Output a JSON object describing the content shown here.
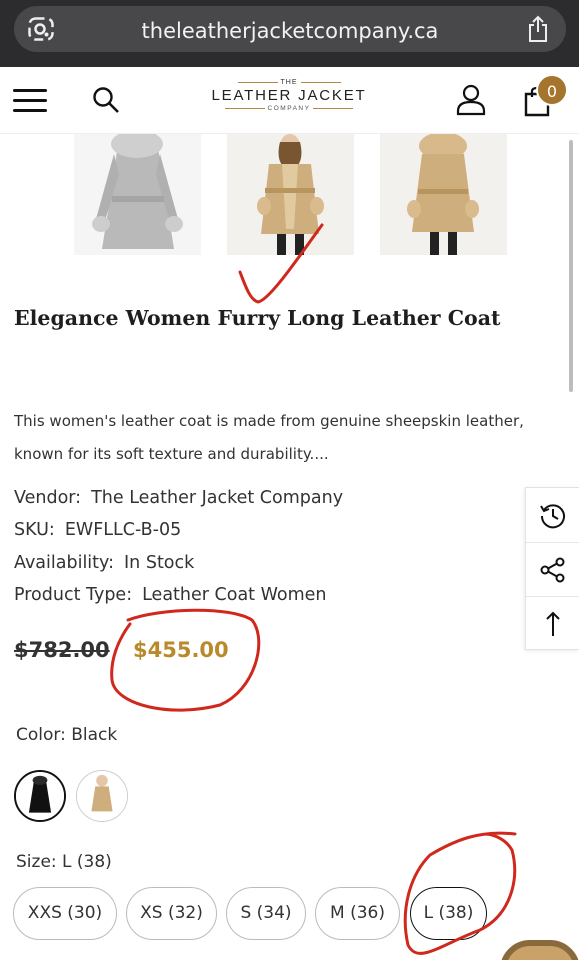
{
  "browser": {
    "url": "theleatherjacketcompany.ca"
  },
  "header": {
    "logo_the": "THE",
    "logo_main": "LEATHER JACKET",
    "logo_company": "COMPANY",
    "cart_count": "0"
  },
  "product": {
    "title": "Elegance Women Furry Long Leather Coat",
    "description": "This women's leather coat is made from genuine sheepskin leather, known for its soft texture and durability....",
    "vendor_label": "Vendor:",
    "vendor": "The Leather Jacket Company",
    "sku_label": "SKU:",
    "sku": "EWFLLC-B-05",
    "availability_label": "Availability:",
    "availability": "In Stock",
    "type_label": "Product Type:",
    "type": "Leather Coat Women",
    "old_price": "$782.00",
    "new_price": "$455.00",
    "color_label": "Color:",
    "color_value": "Black",
    "size_label": "Size:",
    "size_value": "L (38)",
    "sizes": [
      "XXS (30)",
      "XS (32)",
      "S (34)",
      "M (36)",
      "L (38)"
    ]
  },
  "colors": {
    "accent_gold": "#b88a2b",
    "cart_badge": "#a5752e",
    "annotation_red": "#d0281c"
  },
  "icons": [
    "lens-icon",
    "share-icon",
    "menu-icon",
    "search-icon",
    "account-icon",
    "cart-icon",
    "history-icon",
    "share-nodes-icon",
    "arrow-up-icon"
  ]
}
